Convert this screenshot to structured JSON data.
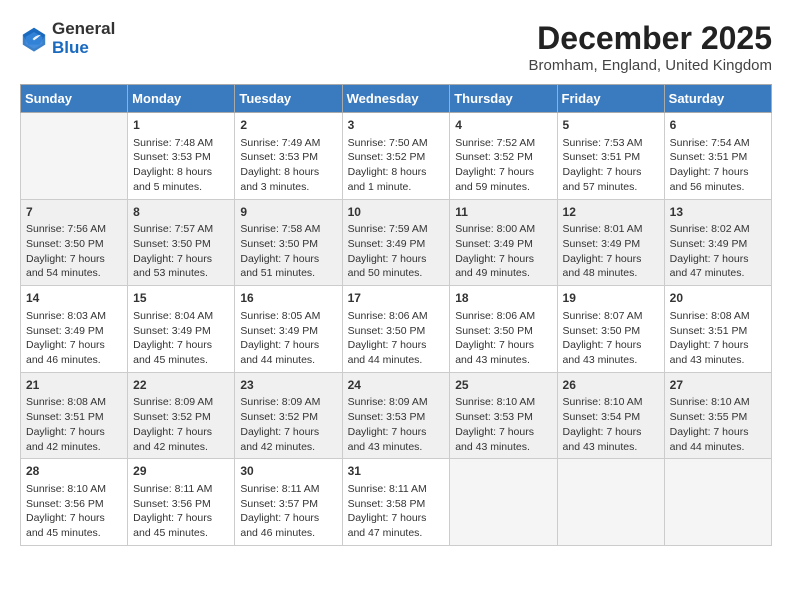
{
  "logo": {
    "text_general": "General",
    "text_blue": "Blue"
  },
  "title": "December 2025",
  "subtitle": "Bromham, England, United Kingdom",
  "days_of_week": [
    "Sunday",
    "Monday",
    "Tuesday",
    "Wednesday",
    "Thursday",
    "Friday",
    "Saturday"
  ],
  "weeks": [
    [
      {
        "day": "",
        "info": ""
      },
      {
        "day": "1",
        "info": "Sunrise: 7:48 AM\nSunset: 3:53 PM\nDaylight: 8 hours\nand 5 minutes."
      },
      {
        "day": "2",
        "info": "Sunrise: 7:49 AM\nSunset: 3:53 PM\nDaylight: 8 hours\nand 3 minutes."
      },
      {
        "day": "3",
        "info": "Sunrise: 7:50 AM\nSunset: 3:52 PM\nDaylight: 8 hours\nand 1 minute."
      },
      {
        "day": "4",
        "info": "Sunrise: 7:52 AM\nSunset: 3:52 PM\nDaylight: 7 hours\nand 59 minutes."
      },
      {
        "day": "5",
        "info": "Sunrise: 7:53 AM\nSunset: 3:51 PM\nDaylight: 7 hours\nand 57 minutes."
      },
      {
        "day": "6",
        "info": "Sunrise: 7:54 AM\nSunset: 3:51 PM\nDaylight: 7 hours\nand 56 minutes."
      }
    ],
    [
      {
        "day": "7",
        "info": "Sunrise: 7:56 AM\nSunset: 3:50 PM\nDaylight: 7 hours\nand 54 minutes."
      },
      {
        "day": "8",
        "info": "Sunrise: 7:57 AM\nSunset: 3:50 PM\nDaylight: 7 hours\nand 53 minutes."
      },
      {
        "day": "9",
        "info": "Sunrise: 7:58 AM\nSunset: 3:50 PM\nDaylight: 7 hours\nand 51 minutes."
      },
      {
        "day": "10",
        "info": "Sunrise: 7:59 AM\nSunset: 3:49 PM\nDaylight: 7 hours\nand 50 minutes."
      },
      {
        "day": "11",
        "info": "Sunrise: 8:00 AM\nSunset: 3:49 PM\nDaylight: 7 hours\nand 49 minutes."
      },
      {
        "day": "12",
        "info": "Sunrise: 8:01 AM\nSunset: 3:49 PM\nDaylight: 7 hours\nand 48 minutes."
      },
      {
        "day": "13",
        "info": "Sunrise: 8:02 AM\nSunset: 3:49 PM\nDaylight: 7 hours\nand 47 minutes."
      }
    ],
    [
      {
        "day": "14",
        "info": "Sunrise: 8:03 AM\nSunset: 3:49 PM\nDaylight: 7 hours\nand 46 minutes."
      },
      {
        "day": "15",
        "info": "Sunrise: 8:04 AM\nSunset: 3:49 PM\nDaylight: 7 hours\nand 45 minutes."
      },
      {
        "day": "16",
        "info": "Sunrise: 8:05 AM\nSunset: 3:49 PM\nDaylight: 7 hours\nand 44 minutes."
      },
      {
        "day": "17",
        "info": "Sunrise: 8:06 AM\nSunset: 3:50 PM\nDaylight: 7 hours\nand 44 minutes."
      },
      {
        "day": "18",
        "info": "Sunrise: 8:06 AM\nSunset: 3:50 PM\nDaylight: 7 hours\nand 43 minutes."
      },
      {
        "day": "19",
        "info": "Sunrise: 8:07 AM\nSunset: 3:50 PM\nDaylight: 7 hours\nand 43 minutes."
      },
      {
        "day": "20",
        "info": "Sunrise: 8:08 AM\nSunset: 3:51 PM\nDaylight: 7 hours\nand 43 minutes."
      }
    ],
    [
      {
        "day": "21",
        "info": "Sunrise: 8:08 AM\nSunset: 3:51 PM\nDaylight: 7 hours\nand 42 minutes."
      },
      {
        "day": "22",
        "info": "Sunrise: 8:09 AM\nSunset: 3:52 PM\nDaylight: 7 hours\nand 42 minutes."
      },
      {
        "day": "23",
        "info": "Sunrise: 8:09 AM\nSunset: 3:52 PM\nDaylight: 7 hours\nand 42 minutes."
      },
      {
        "day": "24",
        "info": "Sunrise: 8:09 AM\nSunset: 3:53 PM\nDaylight: 7 hours\nand 43 minutes."
      },
      {
        "day": "25",
        "info": "Sunrise: 8:10 AM\nSunset: 3:53 PM\nDaylight: 7 hours\nand 43 minutes."
      },
      {
        "day": "26",
        "info": "Sunrise: 8:10 AM\nSunset: 3:54 PM\nDaylight: 7 hours\nand 43 minutes."
      },
      {
        "day": "27",
        "info": "Sunrise: 8:10 AM\nSunset: 3:55 PM\nDaylight: 7 hours\nand 44 minutes."
      }
    ],
    [
      {
        "day": "28",
        "info": "Sunrise: 8:10 AM\nSunset: 3:56 PM\nDaylight: 7 hours\nand 45 minutes."
      },
      {
        "day": "29",
        "info": "Sunrise: 8:11 AM\nSunset: 3:56 PM\nDaylight: 7 hours\nand 45 minutes."
      },
      {
        "day": "30",
        "info": "Sunrise: 8:11 AM\nSunset: 3:57 PM\nDaylight: 7 hours\nand 46 minutes."
      },
      {
        "day": "31",
        "info": "Sunrise: 8:11 AM\nSunset: 3:58 PM\nDaylight: 7 hours\nand 47 minutes."
      },
      {
        "day": "",
        "info": ""
      },
      {
        "day": "",
        "info": ""
      },
      {
        "day": "",
        "info": ""
      }
    ]
  ]
}
